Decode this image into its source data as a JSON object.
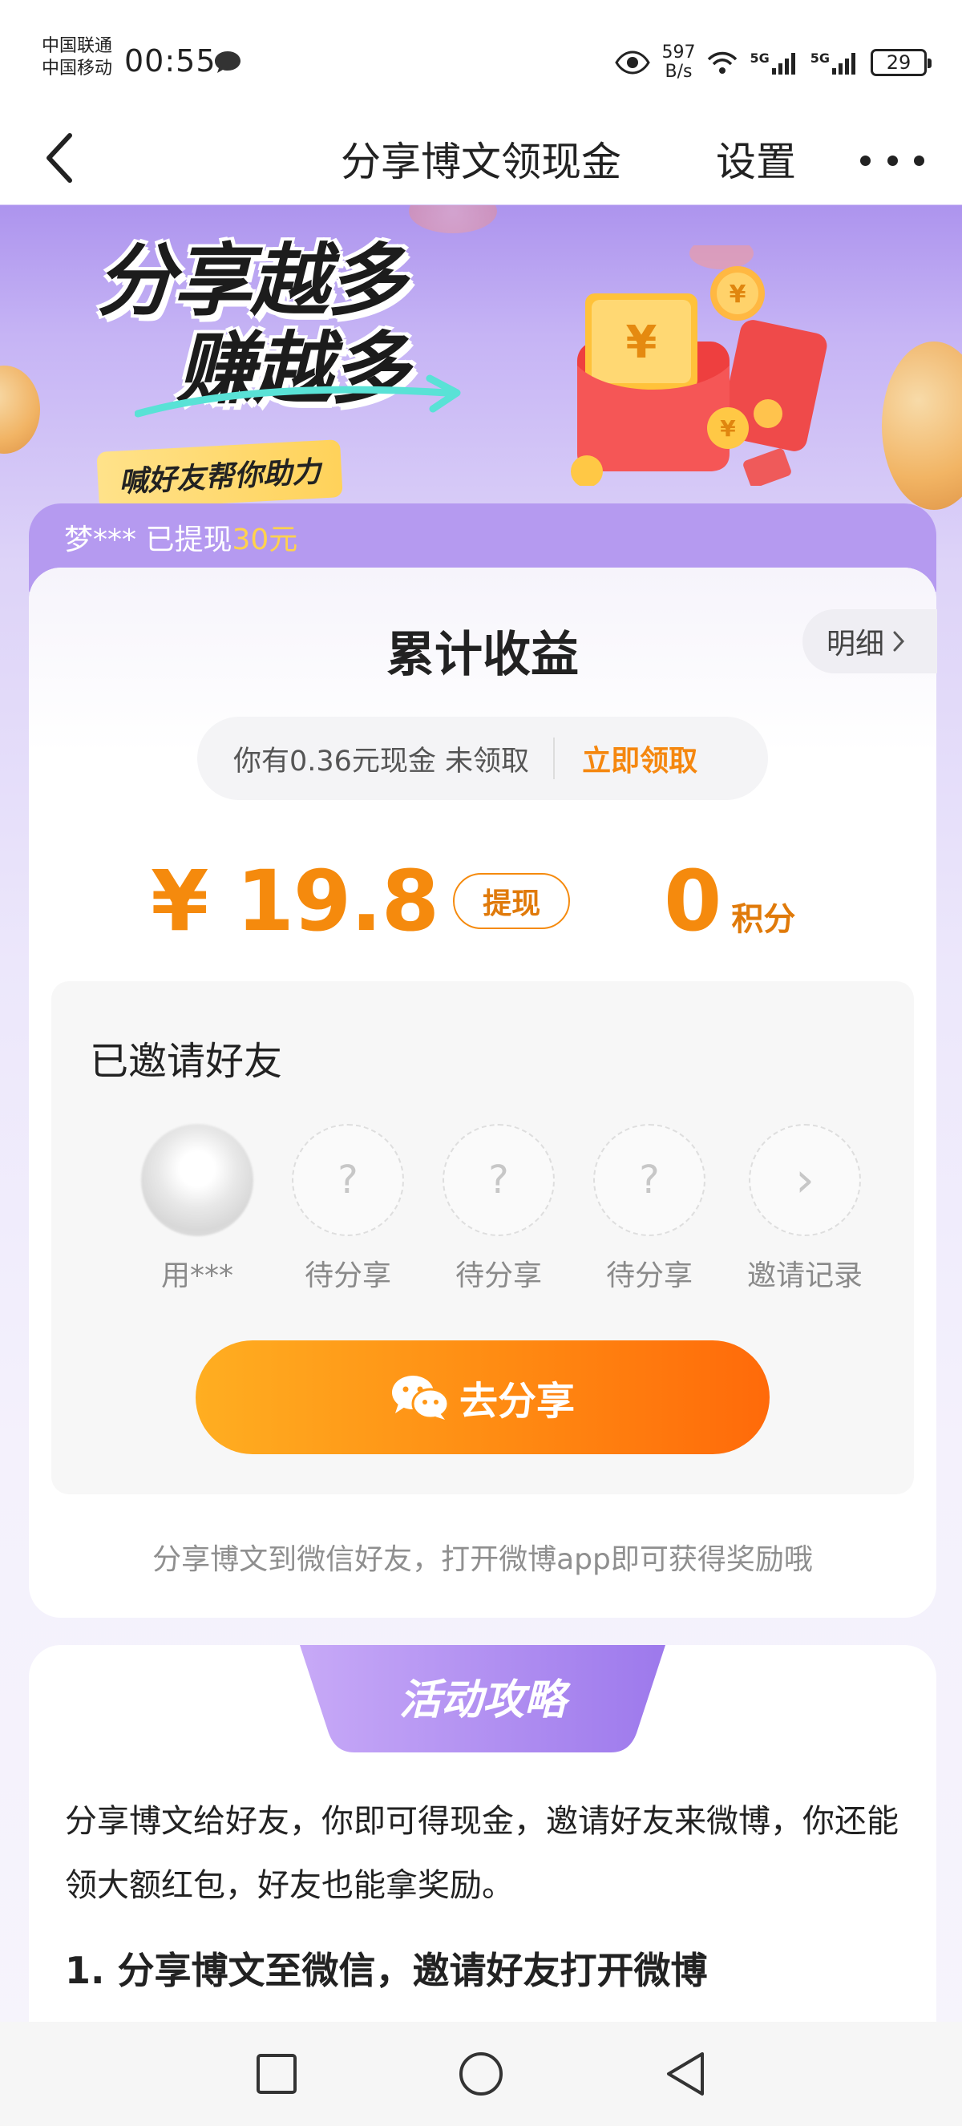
{
  "status_bar": {
    "carrier_1": "中国联通",
    "carrier_2": "中国移动",
    "time": "00:55",
    "net_speed_value": "597",
    "net_speed_unit": "B/s",
    "signal_1": "5G",
    "signal_2": "5G",
    "battery": "29"
  },
  "nav": {
    "title": "分享博文领现金",
    "settings_label": "设置"
  },
  "banner": {
    "headline_1": "分享越多",
    "headline_2": "赚越多",
    "badge": "喊好友帮你助力"
  },
  "ticker": {
    "user": "梦***",
    "action": " 已提现",
    "amount": "30元"
  },
  "earnings": {
    "title": "累计收益",
    "detail_label": "明细",
    "pending_text": "你有0.36元现金 未领取",
    "claim_label": "立即领取",
    "cash_display": "¥ 19.8",
    "withdraw_label": "提现",
    "points_value": "0",
    "points_unit": "积分"
  },
  "invited": {
    "title": "已邀请好友",
    "friends": [
      {
        "label": "用***",
        "glyph": ""
      },
      {
        "label": "待分享",
        "glyph": "?"
      },
      {
        "label": "待分享",
        "glyph": "?"
      },
      {
        "label": "待分享",
        "glyph": "?"
      },
      {
        "label": "邀请记录",
        "glyph": "›"
      }
    ],
    "share_button": "去分享",
    "hint": "分享博文到微信好友，打开微博app即可获得奖励哦"
  },
  "strategy": {
    "tab_label": "活动攻略",
    "paragraph": "分享博文给好友，你即可得现金，邀请好友来微博，你还能领大额红包，好友也能拿奖励。",
    "step_1": "1. 分享博文至微信，邀请好友打开微博"
  },
  "colors": {
    "accent_orange": "#f58a0d",
    "banner_purple": "#ad94ee",
    "ticker_gold": "#ffd24d"
  }
}
